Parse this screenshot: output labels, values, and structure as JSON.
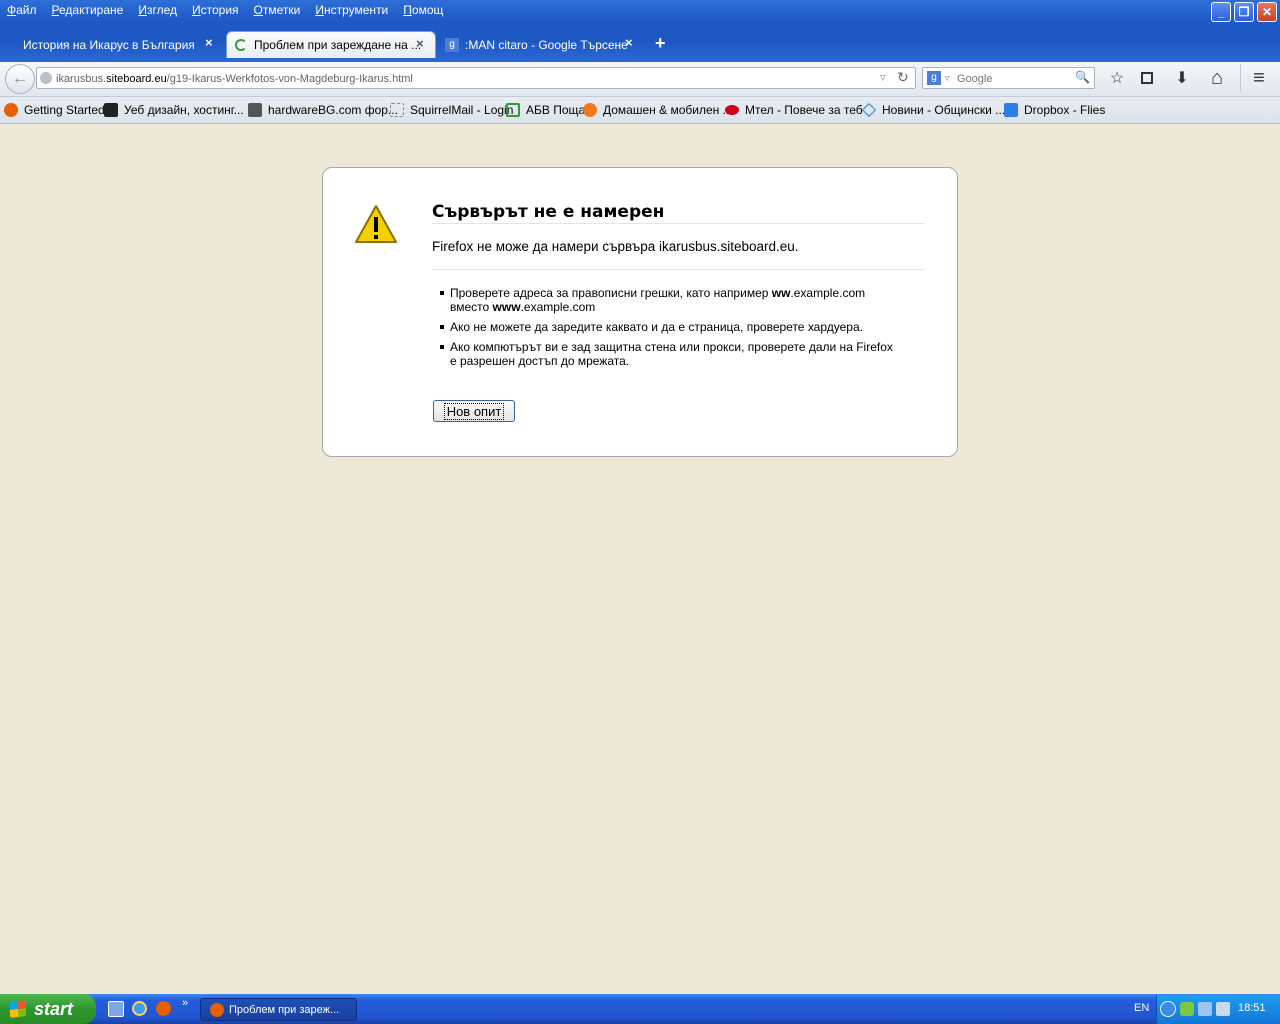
{
  "menu": [
    "Файл",
    "Редактиране",
    "Изглед",
    "История",
    "Отметки",
    "Инструменти",
    "Помощ"
  ],
  "tabs": [
    {
      "label": "История на Икарус в България",
      "active": false
    },
    {
      "label": "Проблем при зареждане на ...",
      "active": true
    },
    {
      "label": ":MAN citaro - Google Търсене",
      "active": false
    }
  ],
  "new_tab": "+",
  "tab_close": "×",
  "url": {
    "prefix": "ikarusbus.",
    "domain": "siteboard.eu",
    "path": "/g19-Ikarus-Werkfotos-von-Magdeburg-Ikarus.html"
  },
  "search": {
    "placeholder": "Google"
  },
  "bookmarks": [
    {
      "label": "Getting Started",
      "color": "#e66000"
    },
    {
      "label": "Уеб дизайн, хостинг...",
      "color": "#222222"
    },
    {
      "label": "hardwareBG.com фор...",
      "color": "#444444"
    },
    {
      "label": "SquirrelMail - Login",
      "color": "#cccccc"
    },
    {
      "label": "АБВ Поща",
      "color": "#2a9d3a"
    },
    {
      "label": "Домашен & мобилен ...",
      "color": "#f07b1c"
    },
    {
      "label": "Мтел - Повече за теб",
      "color": "#d0021b"
    },
    {
      "label": "Новини - Общински ...",
      "color": "#5aa0d8"
    },
    {
      "label": "Dropbox - Flies",
      "color": "#2b7de9"
    }
  ],
  "error": {
    "title": "Сървърът не е намерен",
    "description": "Firefox не може да намери сървъра ikarusbus.siteboard.eu.",
    "items": [
      [
        "Проверете адреса за правописни грешки, като например ",
        "ww",
        ".example.com вместо ",
        "www",
        ".example.com"
      ],
      "Ако не можете да заредите каквато и да е страница, проверете хардуера.",
      "Ако компютърът ви е зад защитна стена или прокси, проверете дали на Firefox е разрешен достъп до мрежата."
    ],
    "retry_label": "Нов опит"
  },
  "taskbar": {
    "start_label": "start",
    "task_label": "Проблем при зареж...",
    "lang": "EN",
    "time": "18:51",
    "chevron": "»"
  },
  "window_buttons": {
    "minimize": "_",
    "restore": "❐",
    "close": "✕"
  },
  "icons": {
    "back": "←",
    "reload": "↻",
    "dropdown": "▿",
    "star": "☆",
    "download": "⬇",
    "home": "⌂",
    "menu": "≡",
    "search": "🔍",
    "warning": "!"
  }
}
